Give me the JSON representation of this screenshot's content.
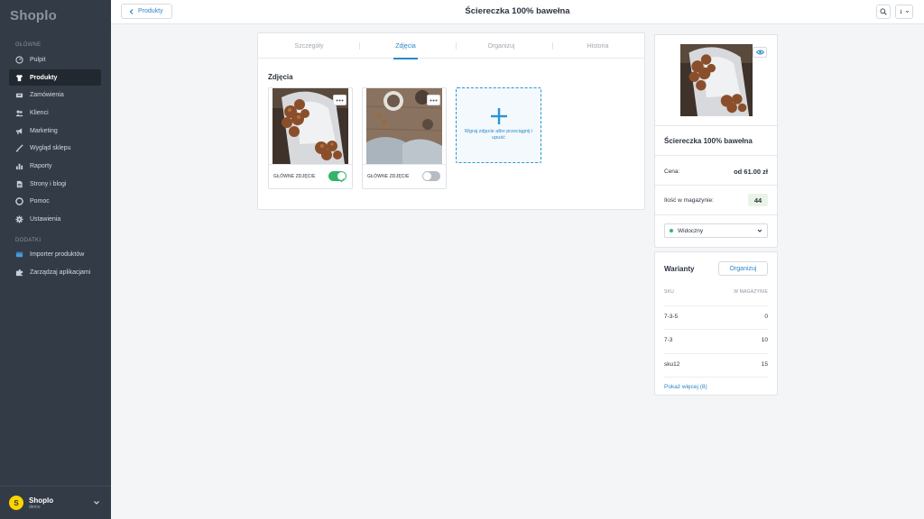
{
  "sidebar": {
    "logo": "Shoplo",
    "sections": {
      "main": "GŁÓWNE",
      "addons": "DODATKI"
    },
    "items": [
      {
        "label": "Pulpit",
        "icon": "dashboard-icon"
      },
      {
        "label": "Produkty",
        "icon": "tshirt-icon"
      },
      {
        "label": "Zamówienia",
        "icon": "inbox-icon"
      },
      {
        "label": "Klienci",
        "icon": "users-icon"
      },
      {
        "label": "Marketing",
        "icon": "megaphone-icon"
      },
      {
        "label": "Wygląd sklepu",
        "icon": "brush-icon"
      },
      {
        "label": "Raporty",
        "icon": "bar-chart-icon"
      },
      {
        "label": "Strony i blogi",
        "icon": "document-icon"
      },
      {
        "label": "Pomoc",
        "icon": "lifebuoy-icon"
      },
      {
        "label": "Ustawienia",
        "icon": "gear-icon"
      }
    ],
    "addons": [
      {
        "label": "Importer produktów",
        "icon": "importer-icon"
      },
      {
        "label": "Zarządzaj aplikacjami",
        "icon": "puzzle-icon"
      }
    ],
    "store": {
      "initial": "S",
      "name": "Shoplo",
      "sub": "demo"
    }
  },
  "topbar": {
    "back_label": "Produkty",
    "title": "Ściereczka 100% bawełna"
  },
  "tabs": [
    {
      "label": "Szczegóły",
      "active": false
    },
    {
      "label": "Zdjęcia",
      "active": true
    },
    {
      "label": "Organizuj",
      "active": false
    },
    {
      "label": "Historia",
      "active": false
    }
  ],
  "photos": {
    "heading": "Zdjęcia",
    "items": [
      {
        "label": "GŁÓWNE ZDJĘCIE",
        "is_main": true
      },
      {
        "label": "GŁÓWNE ZDJĘCIE",
        "is_main": false
      }
    ],
    "upload_text": "Wgraj zdjęcie albo przeciągnij i upuść"
  },
  "product": {
    "name": "Ściereczka 100% bawełna",
    "price_label": "Cena:",
    "price": "od 61.00 zł",
    "stock_label": "Ilość w magazynie:",
    "stock": "44",
    "status": "Widoczny"
  },
  "variants": {
    "title": "Warianty",
    "organize_label": "Organizuj",
    "col_sku": "SKU",
    "col_stock": "W MAGAZYNIE",
    "rows": [
      {
        "sku": "7-3-5",
        "stock": "0"
      },
      {
        "sku": "7-3",
        "stock": "10"
      },
      {
        "sku": "sku12",
        "stock": "15"
      }
    ],
    "show_more": "Pokaż więcej (8)"
  },
  "colors": {
    "sidebar_bg": "#333b46",
    "accent": "#2a87c9",
    "toggle_on": "#34b46b"
  }
}
